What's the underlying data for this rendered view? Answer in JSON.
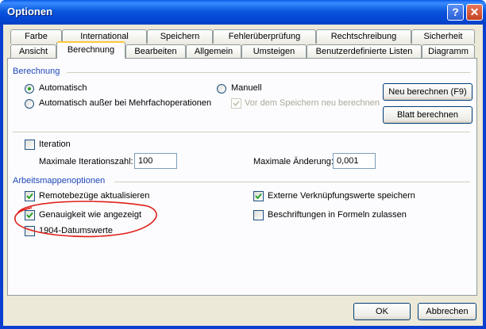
{
  "window": {
    "title": "Optionen"
  },
  "titlebar_buttons": {
    "help": "?",
    "close": "✕"
  },
  "tabs_row1": [
    "Farbe",
    "International",
    "Speichern",
    "Fehlerüberprüfung",
    "Rechtschreibung",
    "Sicherheit"
  ],
  "tabs_row2": [
    "Ansicht",
    "Berechnung",
    "Bearbeiten",
    "Allgemein",
    "Umsteigen",
    "Benutzerdefinierte Listen",
    "Diagramm"
  ],
  "active_tab": "Berechnung",
  "berechnung": {
    "group_label": "Berechnung",
    "radio_automatisch": "Automatisch",
    "radio_automatisch_ausser": "Automatisch außer bei Mehrfachoperationen",
    "radio_manuell": "Manuell",
    "selected": "Automatisch",
    "check_vor_speichern": "Vor dem Speichern neu berechnen",
    "button_neu_berechnen": "Neu berechnen (F9)",
    "button_blatt_berechnen": "Blatt berechnen"
  },
  "iteration": {
    "check_label": "Iteration",
    "checked": false,
    "max_iter_label": "Maximale Iterationszahl:",
    "max_iter_value": "100",
    "max_change_label": "Maximale Änderung:",
    "max_change_value": "0,001"
  },
  "arbeitsmappe": {
    "group_label": "Arbeitsmappenoptionen",
    "remote": {
      "label": "Remotebezüge aktualisieren",
      "checked": true
    },
    "genauigkeit": {
      "label": "Genauigkeit wie angezeigt",
      "checked": true
    },
    "datumswerte": {
      "label": "1904-Datumswerte",
      "checked": false
    },
    "externe": {
      "label": "Externe Verknüpfungswerte speichern",
      "checked": true
    },
    "beschriftungen": {
      "label": "Beschriftungen in Formeln zulassen",
      "checked": false
    }
  },
  "footer": {
    "ok": "OK",
    "cancel": "Abbrechen"
  },
  "colors": {
    "titlebar": "#0054e3",
    "group_label": "#1e47b8",
    "annotation": "#e0201a",
    "tab_highlight": "#ffc83c"
  }
}
